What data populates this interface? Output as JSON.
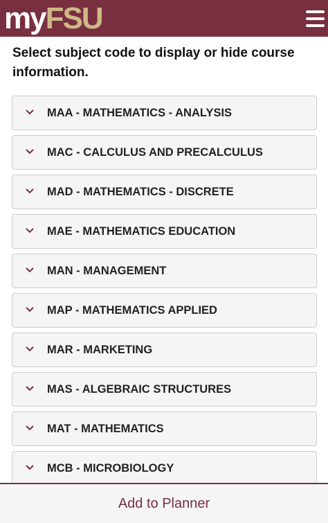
{
  "header": {
    "logo_my": "my",
    "logo_fsu": "FSU",
    "menu_icon": "hamburger-menu-icon"
  },
  "intro_text": "Select subject code to display or hide course information.",
  "subjects": [
    {
      "label": "MAA - MATHEMATICS - ANALYSIS",
      "icon": "chevron-down-icon"
    },
    {
      "label": "MAC - CALCULUS AND PRECALCULUS",
      "icon": "chevron-down-icon"
    },
    {
      "label": "MAD - MATHEMATICS - DISCRETE",
      "icon": "chevron-down-icon"
    },
    {
      "label": "MAE - MATHEMATICS EDUCATION",
      "icon": "chevron-down-icon"
    },
    {
      "label": "MAN - MANAGEMENT",
      "icon": "chevron-down-icon"
    },
    {
      "label": "MAP - MATHEMATICS APPLIED",
      "icon": "chevron-down-icon"
    },
    {
      "label": "MAR - MARKETING",
      "icon": "chevron-down-icon"
    },
    {
      "label": "MAS - ALGEBRAIC STRUCTURES",
      "icon": "chevron-down-icon"
    },
    {
      "label": "MAT - MATHEMATICS",
      "icon": "chevron-down-icon"
    },
    {
      "label": "MCB - MICROBIOLOGY",
      "icon": "chevron-down-icon"
    }
  ],
  "footer": {
    "planner_label": "Add to Planner"
  },
  "colors": {
    "brand_garnet": "#782f40",
    "brand_gold": "#ceb888",
    "panel_bg": "#f5f5f5"
  }
}
